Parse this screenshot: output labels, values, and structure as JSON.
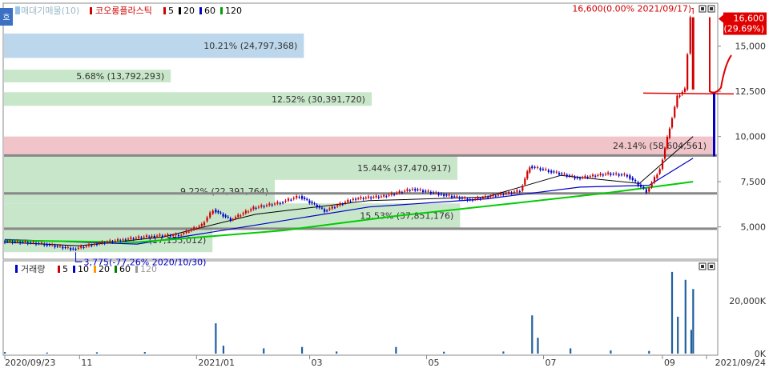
{
  "legend_main": {
    "volume_profile": "매대기매물(10)",
    "series_name": "코오롱플라스틱",
    "ma_items": [
      {
        "label": "5",
        "color": "#d00000"
      },
      {
        "label": "20",
        "color": "#000000"
      },
      {
        "label": "60",
        "color": "#0000c8"
      },
      {
        "label": "120",
        "color": "#00a000"
      }
    ]
  },
  "legend_volume": {
    "title": "거래량",
    "ma_items": [
      {
        "label": "5",
        "color": "#d00000"
      },
      {
        "label": "10",
        "color": "#0000c8"
      },
      {
        "label": "20",
        "color": "#ff9900"
      },
      {
        "label": "60",
        "color": "#008000"
      },
      {
        "label": "120",
        "color": "#999999"
      }
    ]
  },
  "side_tab": "호",
  "colors": {
    "up": "#d00000",
    "down": "#0000c8",
    "ma5": "#d00000",
    "ma20": "#000000",
    "ma60": "#0000c8",
    "ma120": "#00cc00",
    "profile_blue": "#bcd7ec",
    "profile_green": "#c8e6c9",
    "profile_pink": "#f0c4c8"
  },
  "chart_data": [
    {
      "type": "candlestick",
      "title": "",
      "x_axis": {
        "range": [
          "2020/09/23",
          "2021/09/24"
        ],
        "tick_labels": [
          "2020/09/23",
          "11",
          "2021/01",
          "03",
          "05",
          "07",
          "09",
          "2021/09/24"
        ]
      },
      "y_axis": {
        "range": [
          3300,
          17200
        ],
        "tick_labels": [
          "5,000",
          "7,500",
          "10,000",
          "12,500",
          "15,000"
        ]
      },
      "price_series": [
        {
          "date": "2020/09/23",
          "close": 4200
        },
        {
          "date": "2020/10/05",
          "close": 4150
        },
        {
          "date": "2020/10/15",
          "close": 4050
        },
        {
          "date": "2020/10/30",
          "close": 3775
        },
        {
          "date": "2020/11/10",
          "close": 4050
        },
        {
          "date": "2020/11/25",
          "close": 4300
        },
        {
          "date": "2020/12/10",
          "close": 4500
        },
        {
          "date": "2020/12/24",
          "close": 4550
        },
        {
          "date": "2021/01/05",
          "close": 5100
        },
        {
          "date": "2021/01/11",
          "close": 5950
        },
        {
          "date": "2021/01/20",
          "close": 5400
        },
        {
          "date": "2021/02/01",
          "close": 6050
        },
        {
          "date": "2021/02/15",
          "close": 6350
        },
        {
          "date": "2021/02/25",
          "close": 6700
        },
        {
          "date": "2021/03/10",
          "close": 5900
        },
        {
          "date": "2021/03/25",
          "close": 6550
        },
        {
          "date": "2021/04/10",
          "close": 6700
        },
        {
          "date": "2021/04/25",
          "close": 7100
        },
        {
          "date": "2021/05/10",
          "close": 6800
        },
        {
          "date": "2021/05/25",
          "close": 6500
        },
        {
          "date": "2021/06/10",
          "close": 6800
        },
        {
          "date": "2021/06/20",
          "close": 7000
        },
        {
          "date": "2021/06/25",
          "close": 8350
        },
        {
          "date": "2021/07/05",
          "close": 8100
        },
        {
          "date": "2021/07/20",
          "close": 7700
        },
        {
          "date": "2021/08/05",
          "close": 7950
        },
        {
          "date": "2021/08/15",
          "close": 7850
        },
        {
          "date": "2021/08/25",
          "close": 6950
        },
        {
          "date": "2021/09/01",
          "close": 8200
        },
        {
          "date": "2021/09/06",
          "close": 10500
        },
        {
          "date": "2021/09/10",
          "close": 12200
        },
        {
          "date": "2021/09/14",
          "close": 12600
        },
        {
          "date": "2021/09/17",
          "close": 16600
        }
      ],
      "moving_averages": {
        "ma20": [
          {
            "date": "2020/09/23",
            "value": 4150
          },
          {
            "date": "2020/11/01",
            "value": 3950
          },
          {
            "date": "2020/12/15",
            "value": 4450
          },
          {
            "date": "2021/02/01",
            "value": 5700
          },
          {
            "date": "2021/04/01",
            "value": 6450
          },
          {
            "date": "2021/06/01",
            "value": 6650
          },
          {
            "date": "2021/07/10",
            "value": 7850
          },
          {
            "date": "2021/08/20",
            "value": 7400
          },
          {
            "date": "2021/09/17",
            "value": 10000
          }
        ],
        "ma60": [
          {
            "date": "2020/09/23",
            "value": 4300
          },
          {
            "date": "2020/12/01",
            "value": 4050
          },
          {
            "date": "2021/02/01",
            "value": 5100
          },
          {
            "date": "2021/04/01",
            "value": 6100
          },
          {
            "date": "2021/06/01",
            "value": 6550
          },
          {
            "date": "2021/07/20",
            "value": 7200
          },
          {
            "date": "2021/08/25",
            "value": 7300
          },
          {
            "date": "2021/09/17",
            "value": 8800
          }
        ],
        "ma120": [
          {
            "date": "2020/09/23",
            "value": 4250
          },
          {
            "date": "2020/12/01",
            "value": 4150
          },
          {
            "date": "2021/02/15",
            "value": 4800
          },
          {
            "date": "2021/04/15",
            "value": 5600
          },
          {
            "date": "2021/06/15",
            "value": 6300
          },
          {
            "date": "2021/08/01",
            "value": 6850
          },
          {
            "date": "2021/09/17",
            "value": 7500
          }
        ]
      },
      "volume_profile": [
        {
          "label": "10.21% (24,797,368)",
          "price_low": 14350,
          "price_high": 15700,
          "pct": 10.21,
          "color_key": "profile_blue"
        },
        {
          "label": "5.68% (13,792,293)",
          "price_low": 13000,
          "price_high": 13700,
          "pct": 5.68,
          "color_key": "profile_green"
        },
        {
          "label": "12.52% (30,391,720)",
          "price_low": 11700,
          "price_high": 12450,
          "pct": 12.52,
          "color_key": "profile_green"
        },
        {
          "label": "24.14% (58,604,561)",
          "price_low": 9000,
          "price_high": 10000,
          "pct": 24.14,
          "color_key": "profile_pink"
        },
        {
          "label": "15.44% (37,470,917)",
          "price_low": 7600,
          "price_high": 8900,
          "pct": 15.44,
          "color_key": "profile_green"
        },
        {
          "label": "9.22% (22,391,764)",
          "price_low": 6300,
          "price_high": 7650,
          "pct": 9.22,
          "color_key": "profile_green"
        },
        {
          "label": "15.53% (37,851,176)",
          "price_low": 4950,
          "price_high": 6300,
          "pct": 15.53,
          "color_key": "profile_green"
        },
        {
          "label": "(17,155,012)",
          "price_low": 3600,
          "price_high": 4950,
          "pct": 7.1,
          "color_key": "profile_green"
        }
      ],
      "support_lines": [
        8950,
        6850,
        4900
      ],
      "horizontal_marker": 12400,
      "annotations": [
        {
          "text": "16,600(0.00% 2021/09/17)",
          "date": "2021/09/17",
          "price": 16600,
          "kind": "high"
        },
        {
          "text": "3,775(-77.26% 2020/10/30)",
          "date": "2020/10/30",
          "price": 3775,
          "kind": "low"
        }
      ],
      "current_price": {
        "value": "16,600",
        "change": "(29.69%)"
      }
    },
    {
      "type": "bar",
      "title": "거래량",
      "y_axis": {
        "range": [
          0,
          34000
        ],
        "tick_labels": [
          "0K",
          "20,000K"
        ]
      },
      "series": [
        {
          "date": "2020/09/23",
          "volume": 600
        },
        {
          "date": "2020/10/15",
          "volume": 400
        },
        {
          "date": "2020/11/10",
          "volume": 500
        },
        {
          "date": "2020/12/05",
          "volume": 600
        },
        {
          "date": "2021/01/11",
          "volume": 11500
        },
        {
          "date": "2021/01/15",
          "volume": 3000
        },
        {
          "date": "2021/02/05",
          "volume": 2000
        },
        {
          "date": "2021/02/25",
          "volume": 2500
        },
        {
          "date": "2021/03/15",
          "volume": 800
        },
        {
          "date": "2021/04/15",
          "volume": 2500
        },
        {
          "date": "2021/05/10",
          "volume": 700
        },
        {
          "date": "2021/06/10",
          "volume": 800
        },
        {
          "date": "2021/06/25",
          "volume": 14500
        },
        {
          "date": "2021/06/28",
          "volume": 6000
        },
        {
          "date": "2021/07/15",
          "volume": 2000
        },
        {
          "date": "2021/08/05",
          "volume": 1200
        },
        {
          "date": "2021/08/25",
          "volume": 1000
        },
        {
          "date": "2021/09/06",
          "volume": 31000
        },
        {
          "date": "2021/09/09",
          "volume": 14000
        },
        {
          "date": "2021/09/13",
          "volume": 28000
        },
        {
          "date": "2021/09/16",
          "volume": 9000
        },
        {
          "date": "2021/09/17",
          "volume": 24500
        }
      ]
    }
  ]
}
